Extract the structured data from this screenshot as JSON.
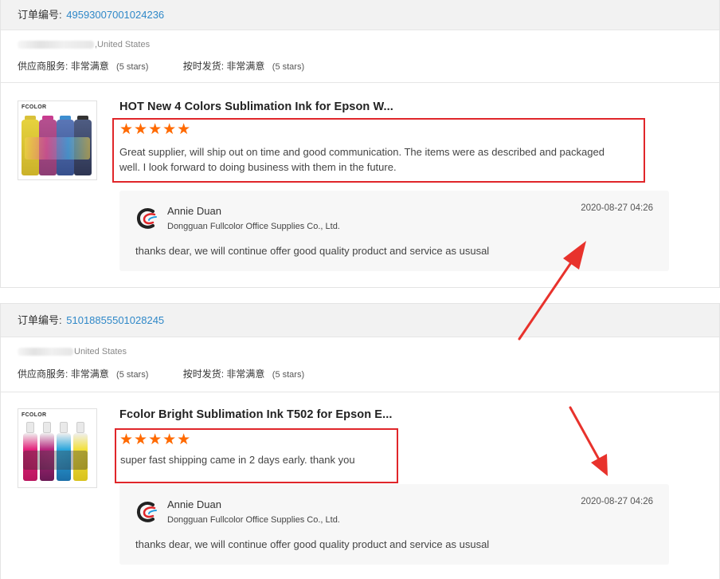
{
  "orders": [
    {
      "order_label": "订单编号:",
      "order_number": "49593007001024236",
      "country": ",United States",
      "supplier_service_label": "供应商服务:",
      "supplier_service_value": "非常满意",
      "supplier_service_stars": "(5 stars)",
      "ship_on_time_label": "按时发货:",
      "ship_on_time_value": "非常满意",
      "ship_on_time_stars": "(5 stars)",
      "product_title": "HOT New 4 Colors Sublimation Ink for Epson W...",
      "product_image_logo": "FCOLOR",
      "rating_stars": "★★★★★",
      "rating": 5,
      "review_line1": "Great supplier, will ship out on time and good communication. The items were as described and packaged",
      "review_line2": "well. I look forward to doing business with them in the future.",
      "reply": {
        "name": "Annie Duan",
        "company": "Dongguan Fullcolor Office Supplies Co., Ltd.",
        "date": "2020-08-27 04:26",
        "text": "thanks dear, we will continue offer good quality product and service as ususal"
      }
    },
    {
      "order_label": "订单编号:",
      "order_number": "51018855501028245",
      "country": "United States",
      "supplier_service_label": "供应商服务:",
      "supplier_service_value": "非常满意",
      "supplier_service_stars": "(5 stars)",
      "ship_on_time_label": "按时发货:",
      "ship_on_time_value": "非常满意",
      "ship_on_time_stars": "(5 stars)",
      "product_title": "Fcolor Bright Sublimation Ink T502 for Epson E...",
      "product_image_logo": "FCOLOR",
      "rating_stars": "★★★★★",
      "rating": 5,
      "review_line1": "super fast shipping came in 2 days early.  thank you",
      "reply": {
        "name": "Annie Duan",
        "company": "Dongguan Fullcolor Office Supplies Co., Ltd.",
        "date": "2020-08-27 04:26",
        "text": "thanks dear, we will continue offer good quality product and service as ususal"
      }
    }
  ],
  "colors": {
    "order_number": "#2f88c8",
    "stars": "#ff6a00",
    "highlight_box": "#e0262a",
    "annotation_arrow": "#e8322c"
  }
}
